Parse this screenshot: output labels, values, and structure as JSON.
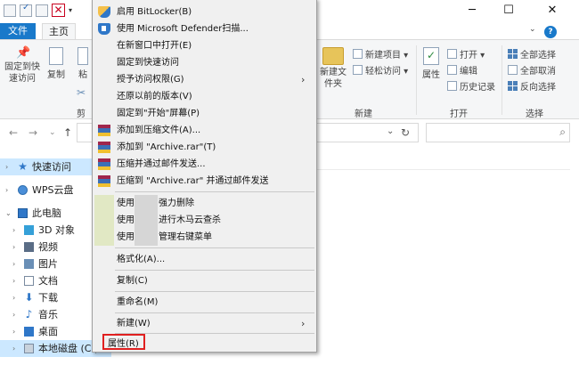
{
  "ribbon": {
    "tab_file": "文件",
    "tab_home": "主页",
    "pin_quick_access": "固定到快速访问",
    "copy": "复制",
    "paste_partial": "粘",
    "clipboard_partial": "剪",
    "new_item": "新建项目",
    "easy_access": "轻松访问",
    "new_folder": "新建文件夹",
    "group_new": "新建",
    "properties": "属性",
    "open": "打开",
    "edit": "编辑",
    "history": "历史记录",
    "group_open": "打开",
    "select_all": "全部选择",
    "select_none": "全部取消",
    "invert_selection": "反向选择",
    "group_select": "选择"
  },
  "nav_pane": {
    "items": [
      {
        "label": "快速访问"
      },
      {
        "label": "WPS云盘"
      },
      {
        "label": "此电脑"
      },
      {
        "label": "3D 对象"
      },
      {
        "label": "视频"
      },
      {
        "label": "图片"
      },
      {
        "label": "文档"
      },
      {
        "label": "下载"
      },
      {
        "label": "音乐"
      },
      {
        "label": "桌面"
      },
      {
        "label": "本地磁盘 (C:)"
      }
    ]
  },
  "menu": {
    "items": [
      {
        "label": "启用 BitLocker(B)"
      },
      {
        "label": "使用 Microsoft Defender扫描..."
      },
      {
        "label": "在新窗口中打开(E)"
      },
      {
        "label": "固定到快速访问"
      },
      {
        "label": "授予访问权限(G)"
      },
      {
        "label": "还原以前的版本(V)"
      },
      {
        "label": "固定到\"开始\"屏幕(P)"
      },
      {
        "label": "添加到压缩文件(A)..."
      },
      {
        "label": "添加到 \"Archive.rar\"(T)"
      },
      {
        "label": "压缩并通过邮件发送..."
      },
      {
        "label": "压缩到 \"Archive.rar\" 并通过邮件发送"
      },
      {
        "label": "使用"
      },
      {
        "label": "强力删除"
      },
      {
        "label": "使用"
      },
      {
        "label": "进行木马云查杀"
      },
      {
        "label": "使用"
      },
      {
        "label": "管理右键菜单"
      },
      {
        "label": "格式化(A)..."
      },
      {
        "label": "复制(C)"
      },
      {
        "label": "重命名(M)"
      },
      {
        "label": "新建(W)"
      },
      {
        "label": "属性(R)"
      }
    ]
  },
  "colors": {
    "accent": "#1979ca",
    "highlight_border": "#e02020",
    "selected_bg": "#cce8ff"
  }
}
